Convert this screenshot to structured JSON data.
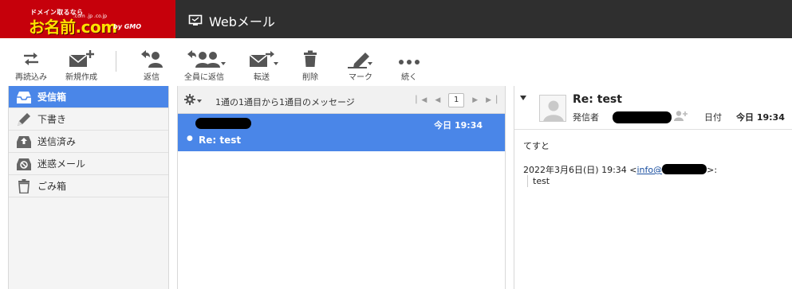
{
  "header": {
    "logo_small": "ドメイン取るなら",
    "logo_main": "お名前.com",
    "logo_domains": ".com .jp .co.jp",
    "logo_gmo": "by GMO",
    "app_title": "Webメール"
  },
  "toolbar": {
    "reload": "再読込み",
    "compose": "新規作成",
    "reply": "返信",
    "reply_all": "全員に返信",
    "forward": "転送",
    "delete": "削除",
    "mark": "マーク",
    "more": "続く"
  },
  "folders": [
    {
      "label": "受信箱",
      "icon": "inbox-icon",
      "active": true
    },
    {
      "label": "下書き",
      "icon": "pencil-icon"
    },
    {
      "label": "送信済み",
      "icon": "sent-icon"
    },
    {
      "label": "迷惑メール",
      "icon": "spam-icon"
    },
    {
      "label": "ごみ箱",
      "icon": "trash-icon"
    }
  ],
  "list": {
    "count_text": "1通の1通目から1通目のメッセージ",
    "page": "1",
    "messages": [
      {
        "date": "今日 19:34",
        "subject": "Re: test"
      }
    ]
  },
  "reader": {
    "subject": "Re: test",
    "from_label": "発信者",
    "date_label": "日付",
    "date_value": "今日 19:34",
    "body": "てすと",
    "quote_date": "2022年3月6日(日) 19:34 <",
    "quote_email_prefix": "info@",
    "quote_suffix": ">:",
    "quote_body": "test"
  },
  "colors": {
    "accent": "#4a86e8",
    "header_bg": "#2f2f2f",
    "logo_bg": "#c6000b",
    "logo_text": "#ffe000"
  }
}
